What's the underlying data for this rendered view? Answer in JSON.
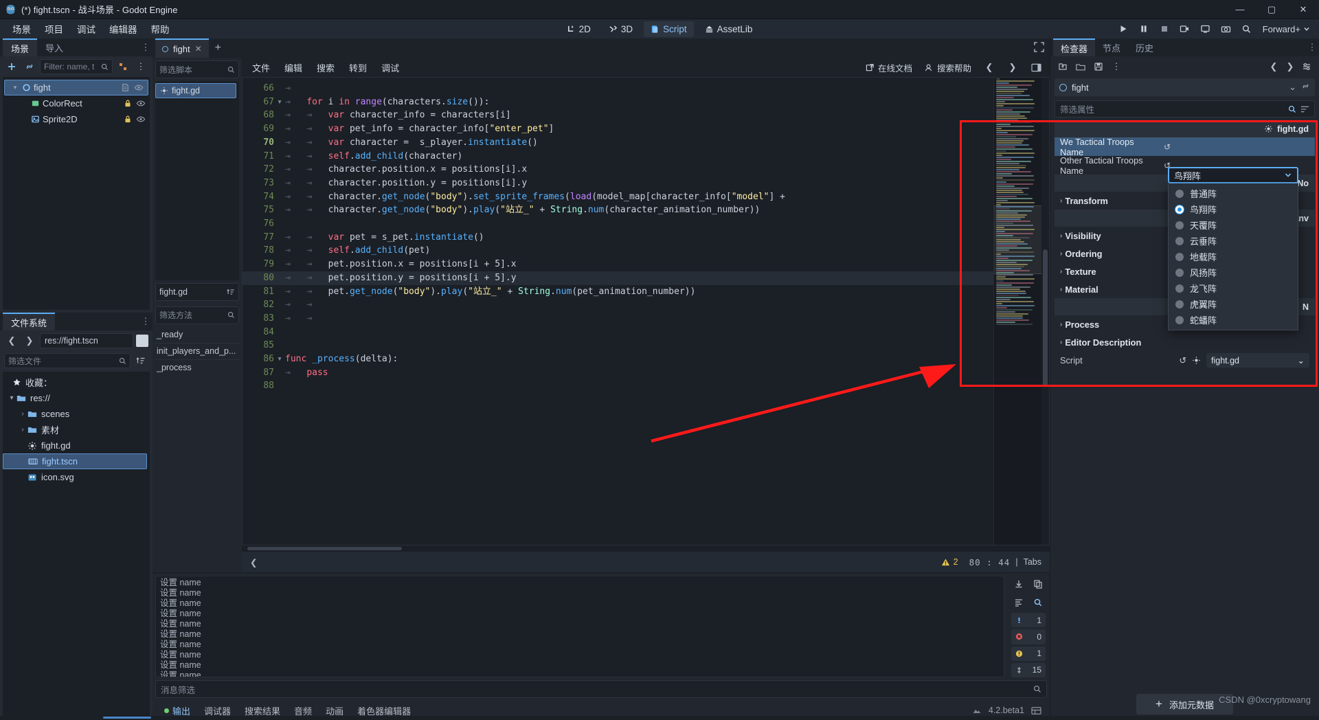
{
  "window": {
    "title": "(*) fight.tscn - 战斗场景 - Godot Engine",
    "minimize": "—",
    "maximize": "▢",
    "close": "✕"
  },
  "menubar": {
    "items": [
      "场景",
      "项目",
      "调试",
      "编辑器",
      "帮助"
    ]
  },
  "main_tabs": [
    {
      "label": "2D",
      "icon": "2d-icon",
      "active": false
    },
    {
      "label": "3D",
      "icon": "3d-icon",
      "active": false
    },
    {
      "label": "Script",
      "icon": "script-icon",
      "active": true
    },
    {
      "label": "AssetLib",
      "icon": "assetlib-icon",
      "active": false
    }
  ],
  "run_tools": {
    "play": "play-icon",
    "pause": "pause-icon",
    "stop": "stop-icon",
    "movie": "movie-icon",
    "remote": "remote-icon",
    "camera": "camera-icon",
    "magnify": "magnify-icon",
    "forward_label": "Forward+"
  },
  "scene_dock": {
    "tabs": [
      {
        "label": "场景",
        "active": true
      },
      {
        "label": "导入",
        "active": false
      }
    ],
    "toolbar": {
      "add": "plus-icon",
      "link": "link-icon",
      "filter_placeholder": "Filter: name, t",
      "search": "search-icon",
      "tree_tool": "tree-tool-icon",
      "more": "more-vertical-icon"
    },
    "tree": [
      {
        "label": "fight",
        "icon": "node2d-icon",
        "depth": 0,
        "selected": true,
        "caret": "▾",
        "trailing": [
          "script-icon",
          "visibility-icon"
        ]
      },
      {
        "label": "ColorRect",
        "icon": "colorrect-icon",
        "depth": 1,
        "selected": false,
        "caret": "",
        "trailing": [
          "lock-icon",
          "visibility-icon"
        ]
      },
      {
        "label": "Sprite2D",
        "icon": "sprite2d-icon",
        "depth": 1,
        "selected": false,
        "caret": "",
        "trailing": [
          "lock-icon",
          "visibility-icon"
        ]
      }
    ]
  },
  "filesystem_dock": {
    "tab_label": "文件系统",
    "path_value": "res://fight.tscn",
    "nav_back": "❮",
    "nav_fwd": "❯",
    "filter_placeholder": "筛选文件",
    "sort_icon": "sort-icon",
    "items": [
      {
        "label": "收藏：",
        "icon": "star-icon",
        "depth": 0,
        "caret": "",
        "selected": false
      },
      {
        "label": "res://",
        "icon": "folder-icon",
        "depth": 0,
        "caret": "▾",
        "selected": false
      },
      {
        "label": "scenes",
        "icon": "folder-icon",
        "depth": 1,
        "caret": "›",
        "selected": false
      },
      {
        "label": "素材",
        "icon": "folder-icon",
        "depth": 1,
        "caret": "›",
        "selected": false
      },
      {
        "label": "fight.gd",
        "icon": "gdscript-icon",
        "depth": 1,
        "caret": "",
        "selected": false
      },
      {
        "label": "fight.tscn",
        "icon": "scene-icon",
        "depth": 1,
        "caret": "",
        "selected": true
      },
      {
        "label": "icon.svg",
        "icon": "image-icon",
        "depth": 1,
        "caret": "",
        "selected": false
      }
    ]
  },
  "script_editor": {
    "tab": {
      "label": "fight",
      "close": "✕"
    },
    "new_tab": "+",
    "expand_icon": "expand-icon",
    "menus": [
      "文件",
      "编辑",
      "搜索",
      "转到",
      "调试"
    ],
    "online_docs": "在线文档",
    "search_help": "搜索帮助",
    "prev": "❮",
    "next": "❯",
    "panel_icon": "panel-icon",
    "script_list": {
      "search_placeholder": "筛选脚本",
      "items": [
        {
          "label": "fight.gd",
          "icon": "gdscript-icon",
          "selected": true
        }
      ],
      "file_name": "fight.gd",
      "sort_icon": "sort-icon",
      "method_search_placeholder": "筛选方法",
      "methods": [
        "_ready",
        "init_players_and_p...",
        "_process"
      ]
    },
    "status": {
      "warn_icon": "warning-icon",
      "warn_count": "2",
      "line": "80",
      "colon": ":",
      "col": "44",
      "sep": "|",
      "indent_mode": "Tabs"
    },
    "code_lines": [
      {
        "n": "66",
        "fold": "",
        "indent": 1,
        "tokens": []
      },
      {
        "n": "67",
        "fold": "▾",
        "indent": 1,
        "tokens": [
          [
            "k",
            "for "
          ],
          [
            "plain",
            "i "
          ],
          [
            "k",
            "in "
          ],
          [
            "kc",
            "range"
          ],
          [
            "plain",
            "(characters."
          ],
          [
            "fn",
            "size"
          ],
          [
            "plain",
            "()):"
          ]
        ]
      },
      {
        "n": "68",
        "fold": "",
        "indent": 2,
        "tokens": [
          [
            "k",
            "var "
          ],
          [
            "plain",
            "character_info = characters[i]"
          ]
        ]
      },
      {
        "n": "69",
        "fold": "",
        "indent": 2,
        "tokens": [
          [
            "k",
            "var "
          ],
          [
            "plain",
            "pet_info = character_info["
          ],
          [
            "str",
            "\"enter_pet\""
          ],
          [
            "plain",
            "]"
          ]
        ]
      },
      {
        "n": "70",
        "fold": "",
        "indent": 2,
        "current": true,
        "tokens": [
          [
            "k",
            "var "
          ],
          [
            "plain",
            "character =  s_player."
          ],
          [
            "fn",
            "instantiate"
          ],
          [
            "plain",
            "()"
          ]
        ]
      },
      {
        "n": "71",
        "fold": "",
        "indent": 2,
        "tokens": [
          [
            "k",
            "self"
          ],
          [
            "plain",
            "."
          ],
          [
            "fn",
            "add_child"
          ],
          [
            "plain",
            "(character)"
          ]
        ]
      },
      {
        "n": "72",
        "fold": "",
        "indent": 2,
        "tokens": [
          [
            "plain",
            "character.position.x = positions[i].x"
          ]
        ]
      },
      {
        "n": "73",
        "fold": "",
        "indent": 2,
        "tokens": [
          [
            "plain",
            "character.position.y = positions[i].y"
          ]
        ]
      },
      {
        "n": "74",
        "fold": "",
        "indent": 2,
        "tokens": [
          [
            "plain",
            "character."
          ],
          [
            "fn",
            "get_node"
          ],
          [
            "plain",
            "("
          ],
          [
            "str",
            "\"body\""
          ],
          [
            "plain",
            ")."
          ],
          [
            "fn",
            "set_sprite_frames"
          ],
          [
            "plain",
            "("
          ],
          [
            "kc",
            "load"
          ],
          [
            "plain",
            "(model_map[character_info["
          ],
          [
            "str",
            "\"model\""
          ],
          [
            "plain",
            "] +"
          ]
        ]
      },
      {
        "n": "75",
        "fold": "",
        "indent": 2,
        "tokens": [
          [
            "plain",
            "character."
          ],
          [
            "fn",
            "get_node"
          ],
          [
            "plain",
            "("
          ],
          [
            "str",
            "\"body\""
          ],
          [
            "plain",
            ")."
          ],
          [
            "fn",
            "play"
          ],
          [
            "plain",
            "("
          ],
          [
            "str",
            "\"站立_\""
          ],
          [
            "plain",
            " + "
          ],
          [
            "num",
            "String"
          ],
          [
            "plain",
            "."
          ],
          [
            "fn",
            "num"
          ],
          [
            "plain",
            "(character_animation_number))"
          ]
        ]
      },
      {
        "n": "76",
        "fold": "",
        "indent": 0,
        "tokens": []
      },
      {
        "n": "77",
        "fold": "",
        "indent": 2,
        "tokens": [
          [
            "k",
            "var "
          ],
          [
            "plain",
            "pet = s_pet."
          ],
          [
            "fn",
            "instantiate"
          ],
          [
            "plain",
            "()"
          ]
        ]
      },
      {
        "n": "78",
        "fold": "",
        "indent": 2,
        "tokens": [
          [
            "k",
            "self"
          ],
          [
            "plain",
            "."
          ],
          [
            "fn",
            "add_child"
          ],
          [
            "plain",
            "(pet)"
          ]
        ]
      },
      {
        "n": "79",
        "fold": "",
        "indent": 2,
        "tokens": [
          [
            "plain",
            "pet.position.x = positions[i + 5].x"
          ]
        ]
      },
      {
        "n": "80",
        "fold": "",
        "indent": 2,
        "cursor": true,
        "tokens": [
          [
            "plain",
            "pet.position.y = positions[i + 5].y"
          ]
        ]
      },
      {
        "n": "81",
        "fold": "",
        "indent": 2,
        "tokens": [
          [
            "plain",
            "pet."
          ],
          [
            "fn",
            "get_node"
          ],
          [
            "plain",
            "("
          ],
          [
            "str",
            "\"body\""
          ],
          [
            "plain",
            ")."
          ],
          [
            "fn",
            "play"
          ],
          [
            "plain",
            "("
          ],
          [
            "str",
            "\"站立_\""
          ],
          [
            "plain",
            " + "
          ],
          [
            "num",
            "String"
          ],
          [
            "plain",
            "."
          ],
          [
            "fn",
            "num"
          ],
          [
            "plain",
            "(pet_animation_number))"
          ]
        ]
      },
      {
        "n": "82",
        "fold": "",
        "indent": 2,
        "tokens": []
      },
      {
        "n": "83",
        "fold": "",
        "indent": 2,
        "tokens": []
      },
      {
        "n": "84",
        "fold": "",
        "indent": 0,
        "tokens": []
      },
      {
        "n": "85",
        "fold": "",
        "indent": 0,
        "tokens": []
      },
      {
        "n": "86",
        "fold": "▾",
        "indent": 0,
        "breakpoint": true,
        "tokens": [
          [
            "k",
            "func "
          ],
          [
            "fn",
            "_process"
          ],
          [
            "plain",
            "(delta):"
          ]
        ]
      },
      {
        "n": "87",
        "fold": "",
        "indent": 1,
        "tokens": [
          [
            "k",
            "pass"
          ]
        ]
      },
      {
        "n": "88",
        "fold": "",
        "indent": 0,
        "tokens": []
      }
    ]
  },
  "output_panel": {
    "log_lines": [
      "设置 name",
      "设置 name",
      "设置 name",
      "设置 name",
      "设置 name",
      "设置 name",
      "设置 name",
      "设置 name",
      "设置 name",
      "设置 name",
      "设置 name"
    ],
    "filter_placeholder": "消息筛选",
    "side_buttons": [
      "download-icon",
      "copy-icon",
      "list-icon",
      "search-icon"
    ],
    "counters": [
      {
        "icon": "info-icon",
        "value": "1",
        "color": "#5badf5"
      },
      {
        "icon": "error-icon",
        "value": "0",
        "color": "#e05c5c"
      },
      {
        "icon": "warning-icon",
        "value": "1",
        "color": "#e5c453"
      },
      {
        "icon": "debug-icon",
        "value": "15",
        "color": "#aeb6c2"
      }
    ],
    "tabs": [
      {
        "label": "输出",
        "active": true
      },
      {
        "label": "调试器",
        "active": false
      },
      {
        "label": "搜索结果",
        "active": false
      },
      {
        "label": "音频",
        "active": false
      },
      {
        "label": "动画",
        "active": false
      },
      {
        "label": "着色器编辑器",
        "active": false
      }
    ],
    "version": "4.2.beta1",
    "layout_icon": "layout-icon"
  },
  "inspector": {
    "tabs": [
      {
        "label": "检查器",
        "active": true
      },
      {
        "label": "节点",
        "active": false
      },
      {
        "label": "历史",
        "active": false
      }
    ],
    "toolbar": {
      "load": "open-icon",
      "folder": "folder-icon",
      "save": "save-icon",
      "more": "more-vertical-icon",
      "prev": "❮",
      "next": "❯",
      "tools": "tools-icon"
    },
    "node_name": "fight",
    "node_dropdown": "⌄",
    "chain_icon": "chain-icon",
    "filter_placeholder": "筛选属性",
    "filter_search": "search-icon",
    "filter_tools": "filter-tools-icon",
    "script_group_label": "fight.gd",
    "script_group_icon": "gear-icon",
    "properties": [
      {
        "label": "We Tactical Troops Name",
        "highlight": true,
        "revert": "↺",
        "value": "鸟翔阵"
      },
      {
        "label": "Other Tactical Troops Name",
        "highlight": false,
        "revert": "↺",
        "value": ""
      }
    ],
    "node2d_group": "No",
    "sections": [
      "Transform",
      "Visibility",
      "Ordering",
      "Texture",
      "Material",
      "Process",
      "Editor Description"
    ],
    "canvas_group": "Canv",
    "canvas_icon": "brush-icon",
    "node_group": "N",
    "script_row": {
      "label": "Script",
      "revert": "↺",
      "gear": "gear-icon",
      "value": "fight.gd",
      "caret": "⌄"
    },
    "add_meta": {
      "plus": "+",
      "label": "添加元数据"
    }
  },
  "dropdown": {
    "selected_value": "鸟翔阵",
    "caret": "⌄",
    "options": [
      {
        "label": "普通阵",
        "selected": false
      },
      {
        "label": "鸟翔阵",
        "selected": true
      },
      {
        "label": "天覆阵",
        "selected": false
      },
      {
        "label": "云垂阵",
        "selected": false
      },
      {
        "label": "地载阵",
        "selected": false
      },
      {
        "label": "风扬阵",
        "selected": false
      },
      {
        "label": "龙飞阵",
        "selected": false
      },
      {
        "label": "虎翼阵",
        "selected": false
      },
      {
        "label": "蛇蟠阵",
        "selected": false
      }
    ]
  },
  "annotation": {
    "color": "#ff1a1a",
    "highlight_label": "inspector-property-highlight",
    "arrow_label": "pointer-arrow"
  },
  "watermark": "CSDN @0xcryptowang"
}
